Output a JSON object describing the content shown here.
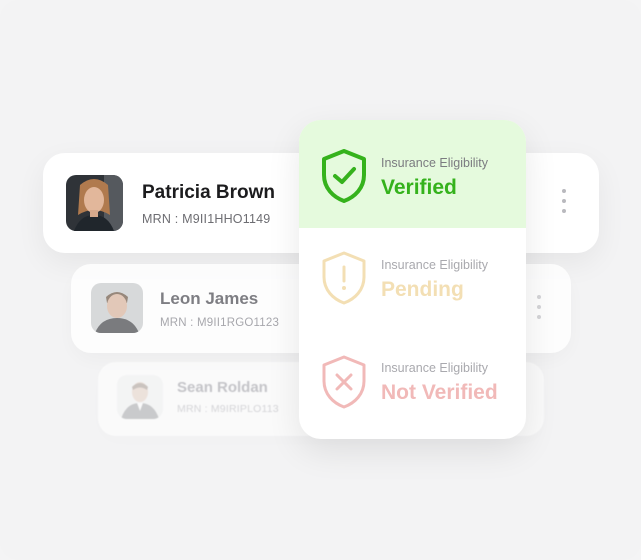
{
  "patients": [
    {
      "name": "Patricia Brown",
      "mrn": "MRN : M9II1HHO1149"
    },
    {
      "name": "Leon James",
      "mrn": "MRN : M9II1RGO1123"
    },
    {
      "name": "Sean Roldan",
      "mrn": "MRN : M9IRIPLO113"
    }
  ],
  "eligibility": {
    "verified": {
      "label": "Insurance Eligibility",
      "value": "Verified",
      "icon": "shield-check-icon",
      "color": "#35b21c"
    },
    "pending": {
      "label": "Insurance Eligibility",
      "value": "Pending",
      "icon": "shield-exclamation-icon",
      "color": "#f3dfb4"
    },
    "not_verified": {
      "label": "Insurance Eligibility",
      "value": "Not Verified",
      "icon": "shield-x-icon",
      "color": "#f1b9b8"
    }
  },
  "colors": {
    "background": "#f3f3f4",
    "verified_bg": "#e5fadd",
    "verified_green": "#35b21c"
  }
}
